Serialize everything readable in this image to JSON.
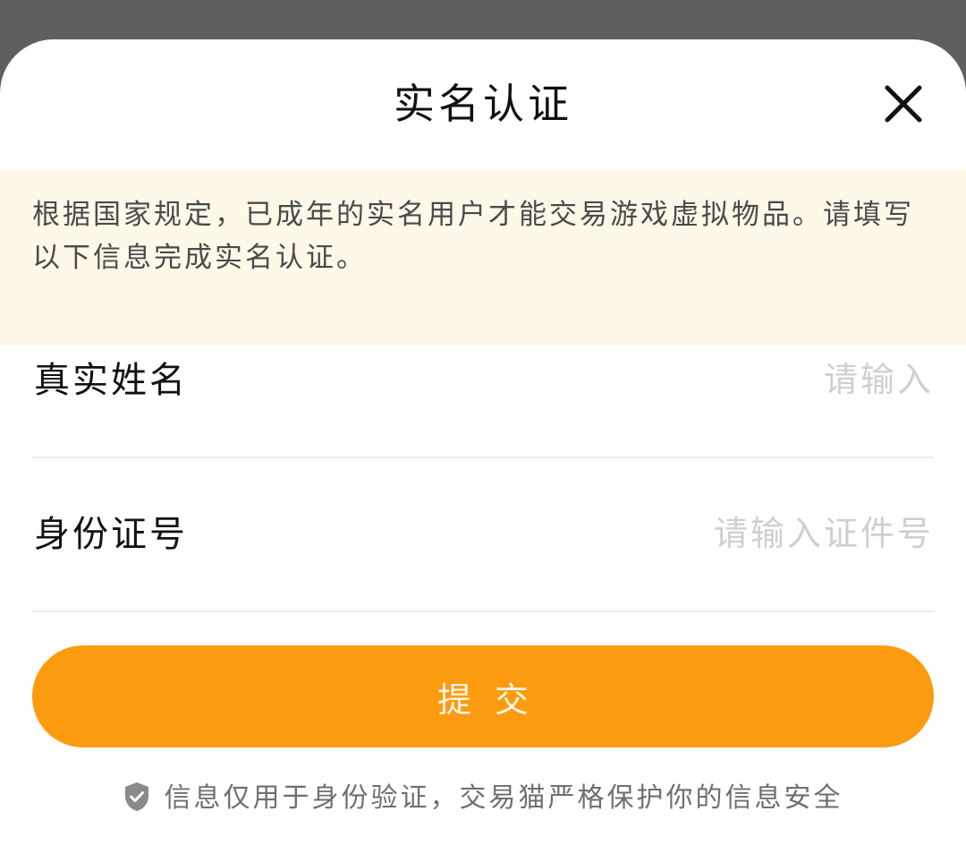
{
  "dialog": {
    "title": "实名认证",
    "close_icon": "close-icon"
  },
  "notice": {
    "text": "根据国家规定，已成年的实名用户才能交易游戏虚拟物品。请填写以下信息完成实名认证。"
  },
  "form": {
    "name": {
      "label": "真实姓名",
      "value": "",
      "placeholder": "请输入"
    },
    "id_number": {
      "label": "身份证号",
      "value": "",
      "placeholder": "请输入证件号"
    },
    "submit_label": "提交"
  },
  "footer": {
    "icon": "shield-check-icon",
    "text": "信息仅用于身份验证，交易猫严格保护你的信息安全"
  },
  "colors": {
    "accent": "#fd9b10",
    "notice_bg": "#fdf8e8",
    "placeholder": "#cfcfcf",
    "backdrop": "#5f5f5f"
  }
}
